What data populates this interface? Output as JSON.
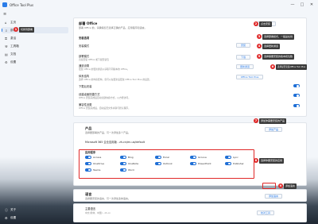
{
  "app": {
    "title": "Office Tool Plus",
    "minimize": "—",
    "maximize": "□",
    "close": "✕"
  },
  "sidebar": {
    "menu_glyph": "≡",
    "items": [
      {
        "label": "主页",
        "icon": "home-icon",
        "glyph": "⌂"
      },
      {
        "label": "部署",
        "icon": "deploy-icon",
        "glyph": "⇩"
      },
      {
        "label": "激活",
        "icon": "key-icon",
        "glyph": "⚿"
      },
      {
        "label": "工具箱",
        "icon": "toolbox-icon",
        "glyph": "⚒"
      },
      {
        "label": "文档",
        "icon": "document-icon",
        "glyph": "▤"
      },
      {
        "label": "设置",
        "icon": "settings-icon",
        "glyph": "⚙"
      }
    ],
    "bottom_items": [
      {
        "label": "关于",
        "icon": "info-icon",
        "glyph": "ⓘ"
      },
      {
        "label": "设置",
        "icon": "gear-icon",
        "glyph": "⚙"
      }
    ],
    "active_index": 1
  },
  "card1": {
    "title": "部署 Office",
    "subtitle": "部署 Office 前，请确保您已选择正确的产品、应用程序和语言。",
    "corner_button": "开始部署",
    "section_label": "安装选项",
    "rows": [
      {
        "title": "安装模式",
        "desc": "",
        "button": "安装"
      },
      {
        "title": "部署模式",
        "desc": "直接安装 Office 或下载安装包",
        "button": "下载"
      },
      {
        "title": "通道设置",
        "desc": "更改 Office 的更新通道以获取不同版本的 Office。",
        "button": "更新通道"
      },
      {
        "title": "体系结构",
        "desc": "选择 Office 的体系结构，您可以在更新后更改 Office Tool Plus 的设置。",
        "button": "Office Tool Plus"
      },
      {
        "title": "下载后安装",
        "desc": "",
        "button": ""
      },
      {
        "title": "创建桌面快捷方式",
        "desc": "Office 安装完成后自动创建快捷方式，以方便访问。",
        "button": ""
      },
      {
        "title": "兼容性设置",
        "desc": "Office 安装完成后，自动设置文件关联与默认程序。",
        "button": ""
      }
    ]
  },
  "card2": {
    "title": "产品",
    "subtitle": "选择要部署的产品，可一次添加多个产品。",
    "corner_button": "添加产品",
    "product_line": "Microsoft 365 企业应用版 - zh-cn/en-us/default",
    "apps_label": "应用程序",
    "apps": [
      [
        "Access",
        "Bing",
        "Excel",
        "Groove",
        "Lync"
      ],
      [
        "OneDrive",
        "OneNote",
        "Outlook",
        "PowerPoint",
        "Publisher"
      ],
      [
        "Teams",
        "Word"
      ]
    ]
  },
  "card3": {
    "title": "语言",
    "subtitle": "选择要安装的语言，可一次添加多种语言。",
    "corner_button": "添加语言",
    "row_label": "主要语言",
    "row_value": "中文(简体，中国) - zh-cn",
    "row_button": "校对工具"
  },
  "annotations": [
    {
      "n": "1",
      "text": "切换到部署"
    },
    {
      "n": "2",
      "text": "点击安装"
    },
    {
      "n": "3",
      "text": "选择部署模式，一般是在线"
    },
    {
      "n": "4",
      "text": "选择更新通道"
    },
    {
      "n": "5",
      "text": "选择需要安装的版本和位数"
    },
    {
      "n": "6",
      "text": "选择是否安装Office Tool Plus"
    },
    {
      "n": "7",
      "text": "添加你需要安装的产品"
    },
    {
      "n": "8",
      "text": "选择你要安装的应用"
    },
    {
      "n": "9",
      "text": "添加语言"
    }
  ],
  "colors": {
    "accent": "#1f6fd6",
    "annotation": "#e02828",
    "callout_bg": "#3a3a3a"
  }
}
